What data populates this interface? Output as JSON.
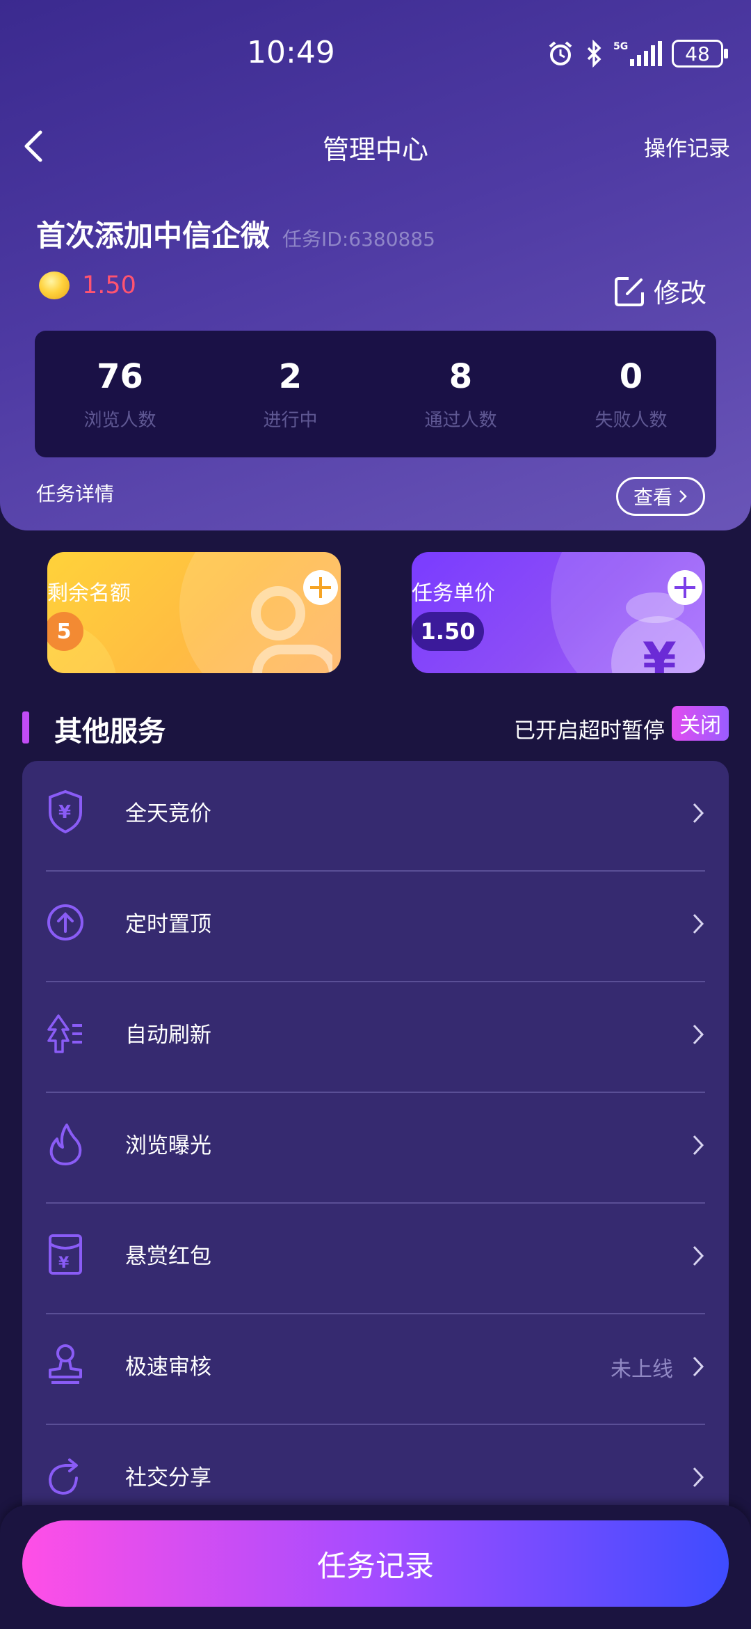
{
  "status_bar": {
    "time": "10:49",
    "battery": "48"
  },
  "nav": {
    "title": "管理中心",
    "right_link": "操作记录"
  },
  "task": {
    "title": "首次添加中信企微",
    "id_label": "任务ID:6380885",
    "price": "1.50",
    "edit_label": "修改"
  },
  "stats": [
    {
      "value": "76",
      "label": "浏览人数"
    },
    {
      "value": "2",
      "label": "进行中"
    },
    {
      "value": "8",
      "label": "通过人数"
    },
    {
      "value": "0",
      "label": "失败人数"
    }
  ],
  "details": {
    "label": "任务详情",
    "view_label": "查看"
  },
  "cards": {
    "quota": {
      "label": "剩余名额",
      "value": "5"
    },
    "unit_price": {
      "label": "任务单价",
      "value": "1.50"
    }
  },
  "services": {
    "title": "其他服务",
    "pause_text": "已开启超时暂停",
    "close_label": "关闭",
    "items": [
      {
        "label": "全天竞价",
        "icon": "shield-yen-icon"
      },
      {
        "label": "定时置顶",
        "icon": "arrow-up-circle-icon"
      },
      {
        "label": "自动刷新",
        "icon": "refresh-tree-icon"
      },
      {
        "label": "浏览曝光",
        "icon": "flame-icon"
      },
      {
        "label": "悬赏红包",
        "icon": "red-envelope-icon"
      },
      {
        "label": "极速审核",
        "icon": "stamp-icon",
        "status": "未上线"
      },
      {
        "label": "社交分享",
        "icon": "share-icon"
      }
    ]
  },
  "bottom": {
    "button_label": "任务记录"
  },
  "colors": {
    "accent_pink": "#ff4fe6",
    "accent_blue": "#3e4cff",
    "price_red": "#ff5470",
    "header_purple": "#4e3aa3"
  }
}
